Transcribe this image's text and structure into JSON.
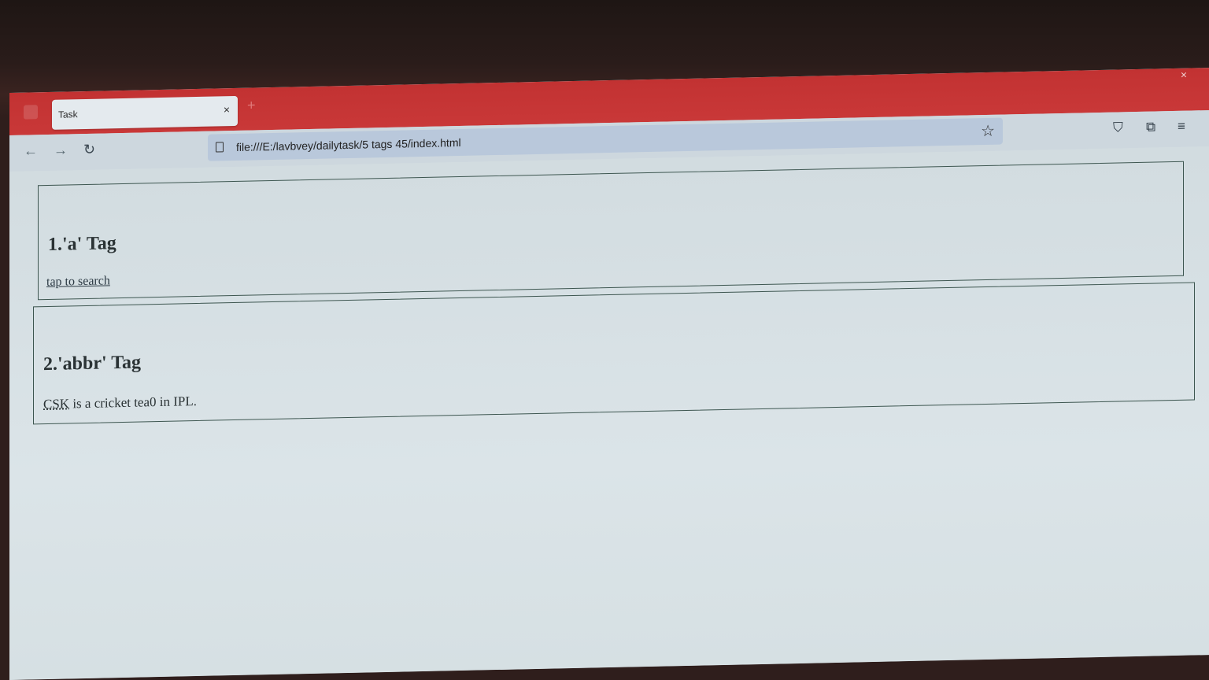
{
  "tab": {
    "title": "Task",
    "close": "×",
    "new_tab": "+"
  },
  "window": {
    "close": "×"
  },
  "nav": {
    "back": "←",
    "forward": "→",
    "reload": "↻"
  },
  "urlbar": {
    "url": "file:///E:/lavbvey/dailytask/5 tags 45/index.html",
    "star": "☆"
  },
  "toolbar": {
    "pocket": "⛉",
    "extensions": "⧉",
    "menu": "≡"
  },
  "sections": [
    {
      "heading": "1.'a' Tag",
      "link_text": "tap to search"
    },
    {
      "heading": "2.'abbr' Tag",
      "abbr": "CSK",
      "text_after": " is a cricket tea0 in IPL."
    }
  ],
  "colors": {
    "tabstrip": "#c93838",
    "page_bg": "#d6e0e3",
    "border": "#3d5650"
  }
}
